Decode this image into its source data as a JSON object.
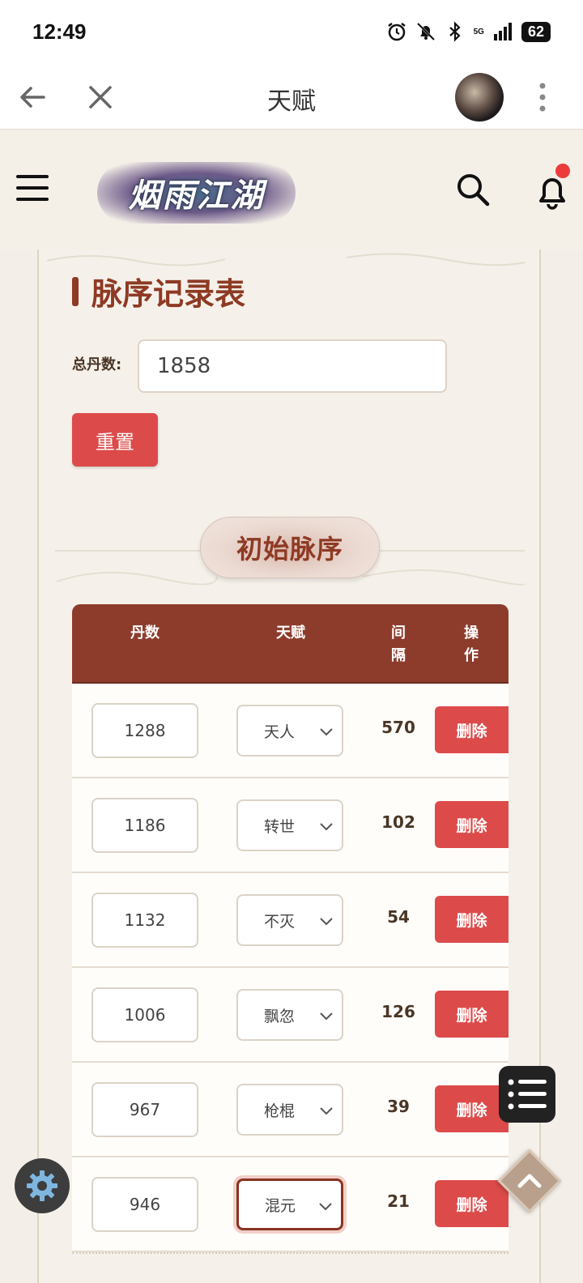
{
  "status_bar": {
    "time": "12:49",
    "network": "5G",
    "battery": "62",
    "icons": [
      "alarm-icon",
      "bell-off-icon",
      "bluetooth-icon",
      "signal-icon"
    ]
  },
  "browser": {
    "title": "天赋",
    "icons": [
      "back-arrow-icon",
      "close-icon",
      "avatar",
      "more-vertical-icon"
    ]
  },
  "site_header": {
    "logo_text": "烟雨江湖",
    "icons": [
      "menu-icon",
      "search-icon",
      "bell-icon"
    ],
    "notification_dot_color": "#ec3b3b"
  },
  "page": {
    "section_title": "脉序记录表",
    "total_label": "总丹数:",
    "total_value": "1858",
    "reset_label": "重置",
    "stage_label": "初始脉序"
  },
  "table": {
    "headers": {
      "dan": "丹数",
      "talent": "天赋",
      "gap_1": "间",
      "gap_2": "隔",
      "op_1": "操",
      "op_2": "作"
    },
    "rows": [
      {
        "dan": "1288",
        "talent": "天人",
        "gap": "570",
        "action": "删除"
      },
      {
        "dan": "1186",
        "talent": "转世",
        "gap": "102",
        "action": "删除"
      },
      {
        "dan": "1132",
        "talent": "不灭",
        "gap": "54",
        "action": "删除"
      },
      {
        "dan": "1006",
        "talent": "飘忽",
        "gap": "126",
        "action": "删除"
      },
      {
        "dan": "967",
        "talent": "枪棍",
        "gap": "39",
        "action": "删除"
      },
      {
        "dan": "946",
        "talent": "混元",
        "gap": "21",
        "action": "删除"
      }
    ]
  },
  "colors": {
    "accent": "#8e3a24",
    "header_bg": "#8d3c2c",
    "button_red": "#dc4b4a",
    "page_bg": "#f3efe8"
  }
}
